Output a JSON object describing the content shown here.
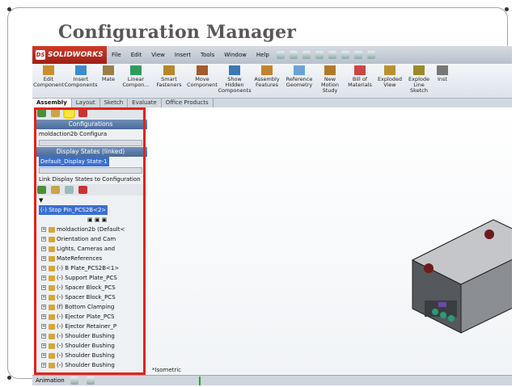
{
  "slide_title": "Configuration Manager",
  "app": {
    "name": "SOLIDWORKS",
    "menus": [
      "File",
      "Edit",
      "View",
      "Insert",
      "Tools",
      "Window",
      "Help"
    ]
  },
  "ribbon": [
    {
      "label": "Edit Component",
      "icon": "edit-component-icon"
    },
    {
      "label": "Insert Components",
      "icon": "insert-components-icon"
    },
    {
      "label": "Mate",
      "icon": "mate-icon"
    },
    {
      "label": "Linear Compon...",
      "icon": "linear-pattern-icon"
    },
    {
      "label": "Smart Fasteners",
      "icon": "smart-fasteners-icon"
    },
    {
      "label": "Move Component",
      "icon": "move-component-icon"
    },
    {
      "label": "Show Hidden Components",
      "icon": "show-hidden-icon"
    },
    {
      "label": "Assembly Features",
      "icon": "assembly-features-icon"
    },
    {
      "label": "Reference Geometry",
      "icon": "reference-geometry-icon"
    },
    {
      "label": "New Motion Study",
      "icon": "motion-study-icon"
    },
    {
      "label": "Bill of Materials",
      "icon": "bom-icon"
    },
    {
      "label": "Exploded View",
      "icon": "exploded-view-icon"
    },
    {
      "label": "Explode Line Sketch",
      "icon": "explode-line-icon"
    },
    {
      "label": "Inst",
      "icon": "instant-icon"
    }
  ],
  "tabs": [
    "Assembly",
    "Layout",
    "Sketch",
    "Evaluate",
    "Office Products"
  ],
  "panel": {
    "configurations_header": "Configurations",
    "configuration": "moldaction2b Configura",
    "display_states_header": "Display States (linked)",
    "display_state": "Default_Display State-1",
    "link_label": "Link Display States to Configuration",
    "selected_part": "(-) Stop Pin_PCS2B<2>",
    "tree": [
      "moldaction2b (Default<",
      "Orientation and Cam",
      "Lights, Cameras and",
      "MateReferences",
      "(-) B Plate_PCS2B<1>",
      "(-) Support Plate_PCS",
      "(-) Spacer Block_PCS",
      "(-) Spacer Block_PCS",
      "(f) Bottom Clamping",
      "(-) Ejector Plate_PCS",
      "(-) Ejector Retainer_P",
      "(-) Shoulder Bushing",
      "(-) Shoulder Bushing",
      "(-) Shoulder Bushing",
      "(-) Shoulder Bushing"
    ]
  },
  "viewport": {
    "view_label": "*Isometric"
  },
  "status": {
    "label": "Animation"
  },
  "colors": {
    "highlight": "#e2231a",
    "brand": "#c0392b",
    "selection": "#3a6fd0"
  }
}
